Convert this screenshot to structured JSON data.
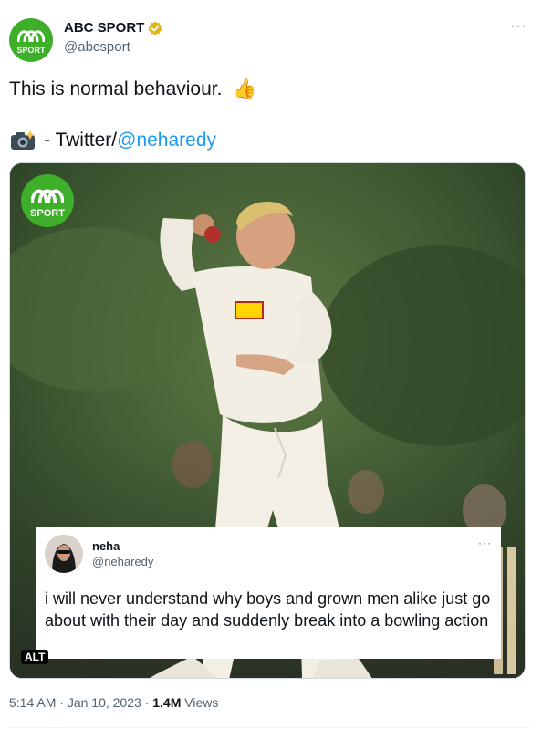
{
  "author": {
    "display_name": "ABC SPORT",
    "handle": "@abcsport",
    "avatar_text": "SPORT",
    "verified_icon": "verified-gold-badge"
  },
  "tweet": {
    "text": "This is normal behaviour.",
    "text_emoji": "👍",
    "credit_icon": "camera-flash-icon",
    "credit_prefix": "- Twitter/",
    "credit_mention": "@neharedy"
  },
  "media": {
    "watermark_text": "SPORT",
    "alt_label": "ALT",
    "quote": {
      "name": "neha",
      "handle": "@neharedy",
      "more": "···",
      "text": "i will never understand why boys and grown men alike just go about with their day and suddenly break into a bowling action"
    }
  },
  "meta": {
    "time": "5:14 AM",
    "separator": "·",
    "date": "Jan 10, 2023",
    "views_count": "1.4M",
    "views_label": "Views"
  },
  "more_icon_text": "···",
  "colors": {
    "brand_green": "#3fae2a",
    "link_blue": "#1d9bf0",
    "verified_gold": "#e2b719",
    "secondary_text": "#536471"
  }
}
